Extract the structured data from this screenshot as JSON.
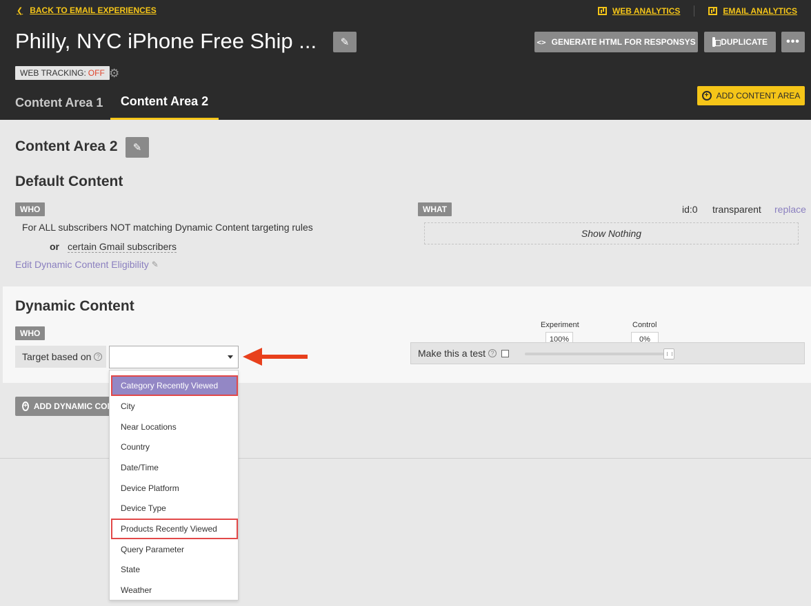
{
  "header": {
    "back_label": "BACK TO EMAIL EXPERIENCES",
    "web_analytics": "WEB ANALYTICS",
    "email_analytics": "EMAIL ANALYTICS",
    "title": "Philly, NYC iPhone Free Ship ...",
    "generate_label": "GENERATE HTML FOR RESPONSYS",
    "duplicate_label": "DUPLICATE",
    "more_label": "•••",
    "tracking_label": "WEB TRACKING:",
    "tracking_value": "OFF",
    "tabs": [
      {
        "label": "Content Area 1"
      },
      {
        "label": "Content Area 2"
      }
    ],
    "add_area_label": "ADD CONTENT AREA"
  },
  "content_area": {
    "title": "Content Area 2",
    "default_heading": "Default Content",
    "who_badge": "WHO",
    "who_text": "For ALL subscribers NOT matching Dynamic Content targeting rules",
    "or_label": "or",
    "gmail_text": "certain Gmail subscribers",
    "edit_eligibility": "Edit Dynamic Content Eligibility",
    "what_badge": "WHAT",
    "id_text": "id:0",
    "transparent_text": "transparent",
    "replace_label": "replace",
    "show_nothing": "Show Nothing"
  },
  "dynamic": {
    "heading": "Dynamic Content",
    "who_badge": "WHO",
    "target_label": "Target based on",
    "select_value": "",
    "test_label": "Make this a test",
    "experiment_label": "Experiment",
    "experiment_value": "100%",
    "control_label": "Control",
    "control_value": "0%",
    "add_label": "ADD DYNAMIC CON"
  },
  "dropdown": {
    "options": [
      {
        "label": "Category Recently Viewed",
        "highlighted": true,
        "boxed": true
      },
      {
        "label": "City"
      },
      {
        "label": "Near Locations"
      },
      {
        "label": "Country"
      },
      {
        "label": "Date/Time"
      },
      {
        "label": "Device Platform"
      },
      {
        "label": "Device Type"
      },
      {
        "label": "Products Recently Viewed",
        "boxed": true
      },
      {
        "label": "Query Parameter"
      },
      {
        "label": "State"
      },
      {
        "label": "Weather"
      }
    ]
  },
  "colors": {
    "header_bg": "#2b2b2b",
    "accent_yellow": "#f5c518",
    "highlight_purple": "#9387c5",
    "callout_red": "#e24848",
    "arrow_red": "#e8401c",
    "link_purple": "#8a7fbf"
  },
  "icons": {
    "back": "chevron-left-icon",
    "analytics": "bar-chart-icon",
    "edit": "pencil-icon",
    "generate": "code-icon",
    "duplicate": "copy-icon",
    "more": "ellipsis-icon",
    "settings": "gear-icon",
    "add": "plus-circle-icon",
    "help": "question-circle-icon",
    "dropdown": "caret-down-icon",
    "annotation": "red-arrow-icon"
  }
}
